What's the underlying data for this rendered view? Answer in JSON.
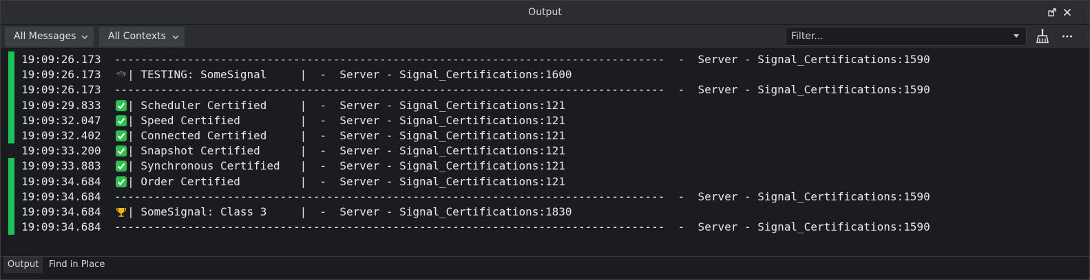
{
  "window": {
    "title": "Output"
  },
  "toolbar": {
    "messages_filter": "All Messages",
    "contexts_filter": "All Contexts",
    "filter_placeholder": "Filter..."
  },
  "colors": {
    "accent_bar": "#1ec25a",
    "check": "#2fbf4f"
  },
  "log": [
    {
      "time": "19:09:26.173",
      "icon": "",
      "body": "-----------------------------------------------------------------------------------  -  Server - Signal_Certifications:1590",
      "marker": true
    },
    {
      "time": "19:09:26.173",
      "icon": "graduation-cap-icon",
      "body": "| TESTING: SomeSignal     |  -  Server - Signal_Certifications:1600",
      "marker": true
    },
    {
      "time": "19:09:26.173",
      "icon": "",
      "body": "-----------------------------------------------------------------------------------  -  Server - Signal_Certifications:1590",
      "marker": true
    },
    {
      "time": "19:09:29.833",
      "icon": "check-icon",
      "body": "| Scheduler Certified     |  -  Server - Signal_Certifications:121",
      "marker": true
    },
    {
      "time": "19:09:32.047",
      "icon": "check-icon",
      "body": "| Speed Certified         |  -  Server - Signal_Certifications:121",
      "marker": true
    },
    {
      "time": "19:09:32.402",
      "icon": "check-icon",
      "body": "| Connected Certified     |  -  Server - Signal_Certifications:121",
      "marker": true
    },
    {
      "time": "19:09:33.200",
      "icon": "check-icon",
      "body": "| Snapshot Certified      |  -  Server - Signal_Certifications:121",
      "marker": false
    },
    {
      "time": "19:09:33.883",
      "icon": "check-icon",
      "body": "| Synchronous Certified   |  -  Server - Signal_Certifications:121",
      "marker": true
    },
    {
      "time": "19:09:34.684",
      "icon": "check-icon",
      "body": "| Order Certified         |  -  Server - Signal_Certifications:121",
      "marker": true
    },
    {
      "time": "19:09:34.684",
      "icon": "",
      "body": "-----------------------------------------------------------------------------------  -  Server - Signal_Certifications:1590",
      "marker": true
    },
    {
      "time": "19:09:34.684",
      "icon": "trophy-icon",
      "body": "| SomeSignal: Class 3     |  -  Server - Signal_Certifications:1830",
      "marker": true
    },
    {
      "time": "19:09:34.684",
      "icon": "",
      "body": "-----------------------------------------------------------------------------------  -  Server - Signal_Certifications:1590",
      "marker": true
    }
  ],
  "tabs": [
    {
      "label": "Output"
    },
    {
      "label": "Find in Place"
    }
  ]
}
